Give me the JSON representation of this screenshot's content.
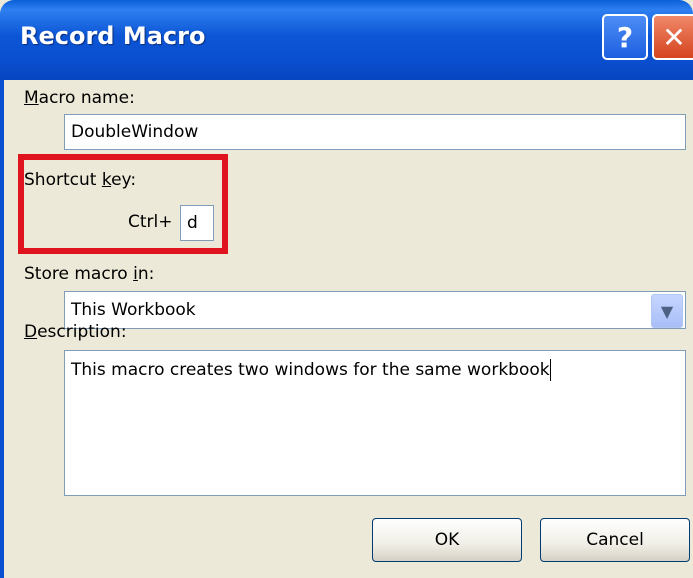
{
  "window": {
    "title": "Record Macro",
    "help_glyph": "?",
    "close_glyph": "✕"
  },
  "macro_name": {
    "label_underlined": "M",
    "label_rest": "acro name:",
    "value": "DoubleWindow"
  },
  "shortcut": {
    "label_pre": "Shortcut ",
    "label_underlined": "k",
    "label_post": "ey:",
    "ctrl_label": "Ctrl+",
    "value": "d"
  },
  "store": {
    "label_pre": "Store macro ",
    "label_underlined": "i",
    "label_post": "n:",
    "selected": "This Workbook"
  },
  "description": {
    "label_underlined": "D",
    "label_rest": "escription:",
    "value": "This macro creates two windows for the same workbook"
  },
  "buttons": {
    "ok": "OK",
    "cancel": "Cancel"
  },
  "colors": {
    "titlebar": "#0A4FD0",
    "highlight": "#E0141E",
    "dialog_bg": "#ECE9D8"
  }
}
